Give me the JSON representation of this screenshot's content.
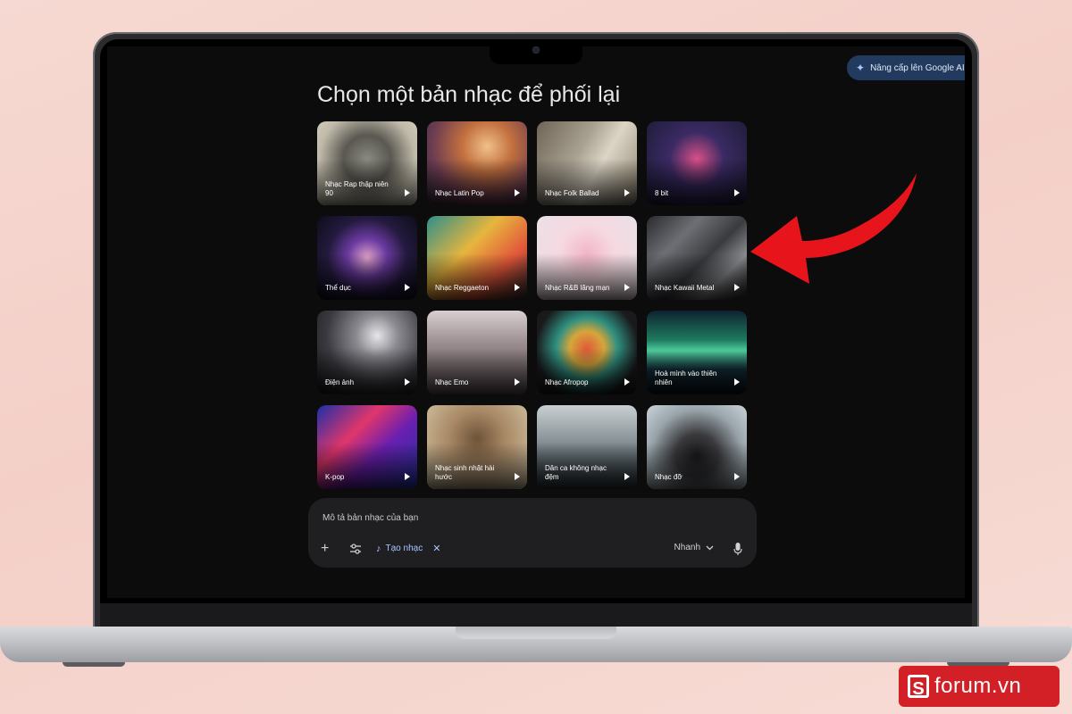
{
  "upgrade": {
    "label": "Nâng cấp lên Google AI"
  },
  "title": "Chọn một bản nhạc để phối lại",
  "cards": [
    {
      "label": "Nhạc Rap thập niên 90",
      "art": "rap90"
    },
    {
      "label": "Nhạc Latin Pop",
      "art": "latinpop"
    },
    {
      "label": "Nhạc Folk Ballad",
      "art": "folk"
    },
    {
      "label": "8 bit",
      "art": "8bit"
    },
    {
      "label": "Thể dục",
      "art": "fitness"
    },
    {
      "label": "Nhạc Reggaeton",
      "art": "reggaeton"
    },
    {
      "label": "Nhạc R&B lãng mạn",
      "art": "rnb"
    },
    {
      "label": "Nhạc Kawaii Metal",
      "art": "kawaii"
    },
    {
      "label": "Điện ảnh",
      "art": "cinema"
    },
    {
      "label": "Nhạc Emo",
      "art": "emo"
    },
    {
      "label": "Nhạc Afropop",
      "art": "afropop"
    },
    {
      "label": "Hoà mình vào thiên nhiên",
      "art": "aurora"
    },
    {
      "label": "K-pop",
      "art": "kpop"
    },
    {
      "label": "Nhạc sinh nhật hài hước",
      "art": "birthday"
    },
    {
      "label": "Dân ca không nhạc đệm",
      "art": "lullaby"
    },
    {
      "label": "Nhạc đỡ",
      "art": "backing"
    }
  ],
  "prompt": {
    "placeholder": "Mô tả bản nhạc của bạn",
    "chip_label": "Tạo nhạc",
    "speed_label": "Nhanh"
  },
  "watermark": {
    "logo_letter": "S",
    "brand": "forum.vn"
  },
  "colors": {
    "accent": "#a8c7ff",
    "arrow": "#e8141b",
    "watermark_bg": "#d32027"
  }
}
